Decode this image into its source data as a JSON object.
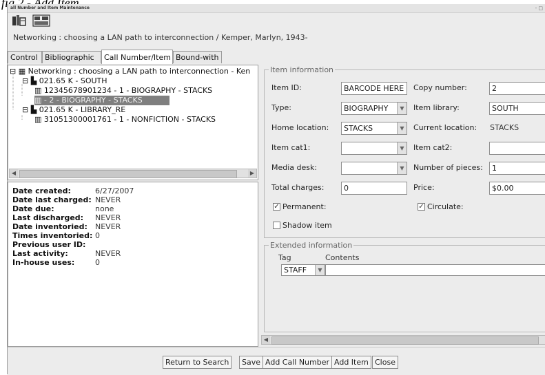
{
  "caption": "fig 2 - Add Item",
  "window": {
    "title": "all Number and Item Maintenance",
    "controls": "- □"
  },
  "toolbar": {
    "icons": [
      "call-number-tool-icon",
      "item-tool-icon"
    ]
  },
  "subtitle": "Networking : choosing a LAN path to interconnection / Kemper, Marlyn, 1943-",
  "tabs": [
    "Control",
    "Bibliographic",
    "Call Number/Item",
    "Bound-with"
  ],
  "tree": {
    "rows": [
      "Networking : choosing a LAN path to interconnection - Ken",
      "021.65 K - SOUTH",
      "12345678901234 - 1 - BIOGRAPHY - STACKS",
      "- 2 - BIOGRAPHY - STACKS",
      "021.65 K - LIBRARY_RE",
      "31051300001761 - 1 - NONFICTION - STACKS"
    ]
  },
  "details": [
    {
      "label": "Date created:",
      "value": "6/27/2007"
    },
    {
      "label": "Date last charged:",
      "value": "NEVER"
    },
    {
      "label": "Date due:",
      "value": "none"
    },
    {
      "label": "Last discharged:",
      "value": "NEVER"
    },
    {
      "label": "Date inventoried:",
      "value": "NEVER"
    },
    {
      "label": "Times inventoried:",
      "value": "0"
    },
    {
      "label": "Previous user ID:",
      "value": ""
    },
    {
      "label": "Last activity:",
      "value": "NEVER"
    },
    {
      "label": "In-house uses:",
      "value": "0"
    }
  ],
  "item_info": {
    "legend": "Item information",
    "item_id_label": "Item ID:",
    "item_id_value": "BARCODE HERE",
    "copy_number_label": "Copy number:",
    "copy_number_value": "2",
    "type_label": "Type:",
    "type_value": "BIOGRAPHY",
    "item_library_label": "Item library:",
    "item_library_value": "SOUTH",
    "home_location_label": "Home location:",
    "home_location_value": "STACKS",
    "current_location_label": "Current location:",
    "current_location_value": "STACKS",
    "item_cat1_label": "Item cat1:",
    "item_cat1_value": "",
    "item_cat2_label": "Item cat2:",
    "item_cat2_value": "",
    "media_desk_label": "Media desk:",
    "media_desk_value": "",
    "pieces_label": "Number of pieces:",
    "pieces_value": "1",
    "total_charges_label": "Total charges:",
    "total_charges_value": "0",
    "price_label": "Price:",
    "price_value": "$0.00",
    "permanent_label": "Permanent:",
    "permanent_checked": true,
    "circulate_label": "Circulate:",
    "circulate_checked": true,
    "shadow_label": "Shadow item",
    "shadow_checked": false
  },
  "extended": {
    "legend": "Extended information",
    "col_tag": "Tag",
    "col_contents": "Contents",
    "rows": [
      {
        "tag": "STAFF",
        "contents": ""
      }
    ]
  },
  "buttons": {
    "return": "Return to Search",
    "save": "Save",
    "add_call": "Add Call Number",
    "add_item": "Add Item",
    "close": "Close"
  }
}
